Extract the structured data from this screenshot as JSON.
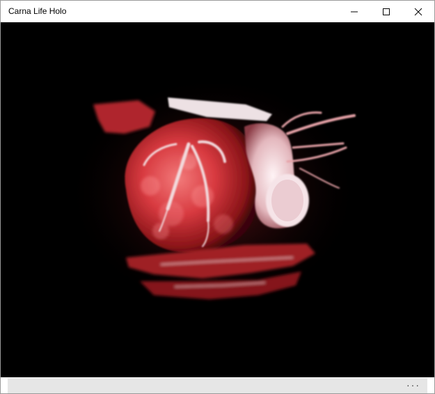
{
  "window": {
    "title": "Carna Life Holo",
    "controls": {
      "minimize_icon": "minimize-icon",
      "maximize_icon": "maximize-icon",
      "close_icon": "close-icon"
    }
  },
  "viewport": {
    "background": "#000000",
    "render_subject": "heart-volume-render",
    "accent_colors": [
      "#d8323c",
      "#f06a6a",
      "#f2e6e8"
    ]
  },
  "appbar": {
    "more_label": "···",
    "background": "#e6e6e6"
  }
}
